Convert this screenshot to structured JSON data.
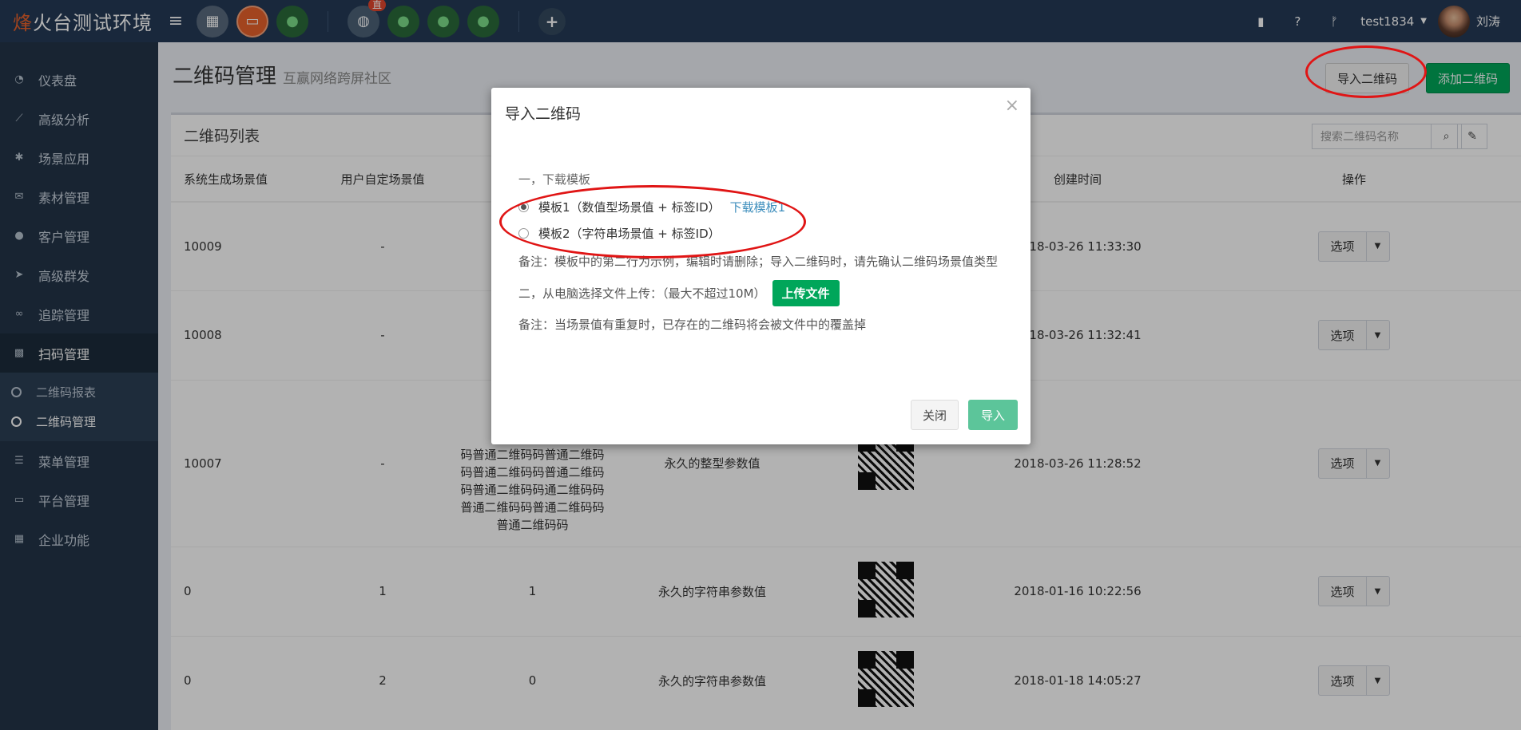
{
  "brand": {
    "accent": "烽",
    "rest": "火台测试环境"
  },
  "topbar": {
    "app_badge": "直",
    "user": "test1834",
    "user_name": "刘涛",
    "icons": [
      "book-icon",
      "help-icon",
      "branch-icon",
      "caret-down-icon"
    ]
  },
  "sidebar": {
    "items": [
      {
        "label": "仪表盘",
        "icon": "dashboard-icon"
      },
      {
        "label": "高级分析",
        "icon": "chart-line-icon"
      },
      {
        "label": "场景应用",
        "icon": "gear-icon"
      },
      {
        "label": "素材管理",
        "icon": "envelope-icon"
      },
      {
        "label": "客户管理",
        "icon": "user-icon"
      },
      {
        "label": "高级群发",
        "icon": "send-icon"
      },
      {
        "label": "追踪管理",
        "icon": "link-icon"
      },
      {
        "label": "扫码管理",
        "icon": "qrcode-icon"
      },
      {
        "label": "菜单管理",
        "icon": "list-icon"
      },
      {
        "label": "平台管理",
        "icon": "desktop-icon"
      },
      {
        "label": "企业功能",
        "icon": "grid-icon"
      }
    ],
    "subitems": [
      {
        "label": "二维码报表"
      },
      {
        "label": "二维码管理"
      }
    ]
  },
  "page": {
    "title": "二维码管理",
    "subtitle": "互赢网络跨屏社区",
    "import_button": "导入二维码",
    "add_button": "添加二维码"
  },
  "panel": {
    "title": "二维码列表",
    "search_placeholder": "搜索二维码名称"
  },
  "table": {
    "headers": [
      "系统生成场景值",
      "用户自定场景值",
      "",
      "",
      "",
      "创建时间",
      "操作"
    ],
    "option_label": "选项",
    "rows": [
      {
        "sys": "10009",
        "user": "-",
        "name": "",
        "type": "",
        "created": "2018-03-26 11:33:30",
        "has_qr": false
      },
      {
        "sys": "10008",
        "user": "-",
        "name": "",
        "type": "",
        "created": "2018-03-26 11:32:41",
        "has_qr": false
      },
      {
        "sys": "10007",
        "user": "-",
        "name": "码普通二维码码普通二维码\n码普通二维码码普通二维码\n码普通二维码码通二维码码\n普通二维码码普通二维码码\n普通二维码码",
        "type": "永久的整型参数值",
        "created": "2018-03-26 11:28:52",
        "has_qr": true
      },
      {
        "sys": "0",
        "user": "1",
        "name": "1",
        "type": "永久的字符串参数值",
        "created": "2018-01-16 10:22:56",
        "has_qr": true
      },
      {
        "sys": "0",
        "user": "2",
        "name": "0",
        "type": "永久的字符串参数值",
        "created": "2018-01-18 14:05:27",
        "has_qr": true
      }
    ]
  },
  "modal": {
    "title": "导入二维码",
    "close_glyph": "×",
    "step1": "一，下载模板",
    "template1": "模板1（数值型场景值 + 标签ID）",
    "template1_link": "下载模板1",
    "template2": "模板2（字符串场景值 + 标签ID）",
    "note1": "备注：模板中的第二行为示例，编辑时请删除；导入二维码时，请先确认二维码场景值类型",
    "step2": "二，从电脑选择文件上传：（最大不超过10M）",
    "upload_button": "上传文件",
    "note2": "备注：当场景值有重复时，已存在的二维码将会被文件中的覆盖掉",
    "close_button": "关闭",
    "import_button": "导入"
  },
  "colors": {
    "accent": "#e8622c",
    "primary_green": "#00a65a",
    "link": "#3c8dbc",
    "annotation": "#e01515"
  }
}
